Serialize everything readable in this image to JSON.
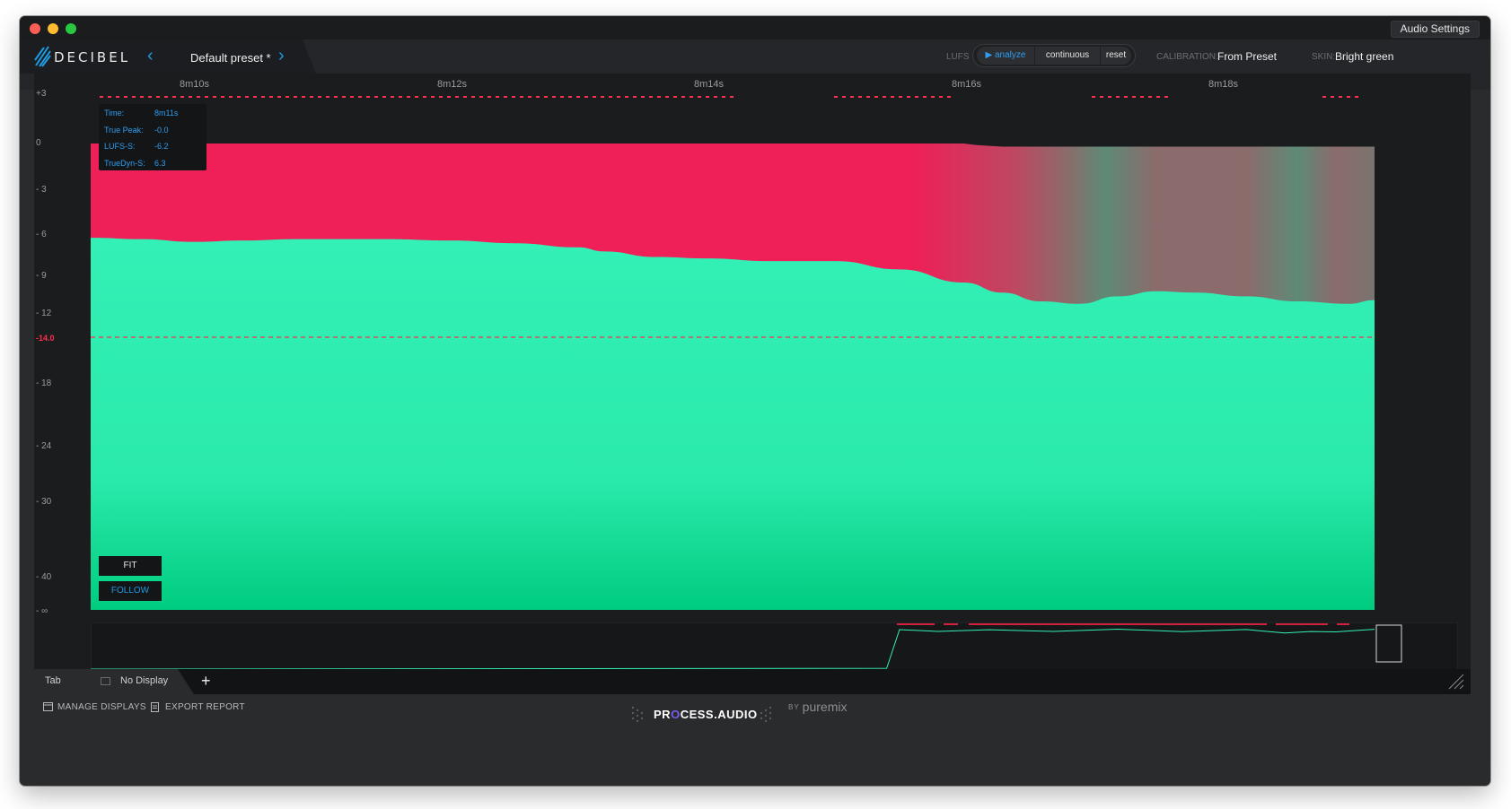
{
  "titlebar": {
    "audio_settings": "Audio Settings"
  },
  "header": {
    "brand": "DECIBEL",
    "preset_name": "Default preset *",
    "lufs_label": "LUFS",
    "analyze": "analyze",
    "continuous": "continuous",
    "reset": "reset",
    "calibration_label": "CALIBRATION:",
    "calibration_value": "From Preset",
    "skin_label": "SKIN:",
    "skin_value": "Bright green"
  },
  "time_axis": [
    "8m10s",
    "8m12s",
    "8m14s",
    "8m16s",
    "8m18s"
  ],
  "y_axis": [
    "+3",
    "0",
    "- 3",
    "- 6",
    "- 9",
    "- 12",
    "-14.0",
    "- 18",
    "- 24",
    "- 30",
    "- 40",
    "- ∞"
  ],
  "info": {
    "rows": [
      {
        "label": "Time:",
        "value": "8m11s"
      },
      {
        "label": "True Peak:",
        "value": "-0.0"
      },
      {
        "label": "LUFS-S:",
        "value": "-6.2"
      },
      {
        "label": "TrueDyn-S:",
        "value": "6.3"
      }
    ]
  },
  "controls": {
    "fit": "FIT",
    "follow": "FOLLOW"
  },
  "tabs": {
    "tab": "Tab",
    "no_display": "No Display",
    "add": "+"
  },
  "footer": {
    "manage_displays": "MANAGE DISPLAYS",
    "export_report": "EXPORT REPORT",
    "process_pre": "PR",
    "process_o": "O",
    "process_post": "CESS.AUDIO",
    "by": "BY",
    "puremix": "puremix"
  },
  "colors": {
    "loudness": "#33f0b6",
    "true_peak": "#ef1f58",
    "target_line": "#ff2f4e",
    "accent": "#1e9be0"
  },
  "chart_data": {
    "type": "area",
    "x_unit": "seconds",
    "xlim": [
      489.2,
      499.2
    ],
    "target_lufs": -14.0,
    "series": [
      {
        "name": "True Peak",
        "x": [
          489.2,
          490,
          491,
          492,
          493,
          494,
          495,
          496,
          496.1,
          496.3,
          497,
          498,
          499.2
        ],
        "values": [
          0.0,
          0.0,
          0.0,
          0.0,
          0.0,
          0.0,
          0.0,
          0.0,
          -0.1,
          -0.2,
          -0.2,
          -0.2,
          -0.2
        ]
      },
      {
        "name": "LUFS-S",
        "x": [
          489.2,
          489.6,
          490,
          490.4,
          490.8,
          491,
          491.5,
          492,
          492.5,
          493,
          493.2,
          493.6,
          494,
          494.5,
          495,
          495.5,
          496,
          496.3,
          496.6,
          496.9,
          497.2,
          497.5,
          497.8,
          498.2,
          498.6,
          499,
          499.2
        ],
        "values": [
          -6.2,
          -6.3,
          -6.5,
          -6.4,
          -6.3,
          -6.3,
          -6.3,
          -6.4,
          -6.6,
          -6.9,
          -7.2,
          -7.6,
          -7.7,
          -7.9,
          -7.9,
          -8.5,
          -9.5,
          -10.3,
          -11.0,
          -11.2,
          -10.6,
          -10.2,
          -10.3,
          -10.6,
          -11.0,
          -11.2,
          -10.9
        ]
      }
    ],
    "overview": {
      "x": [
        0,
        0.62,
        0.63,
        0.66,
        0.7,
        0.75,
        0.8,
        0.85,
        0.9,
        0.93,
        0.95,
        0.97,
        1.0
      ],
      "values": [
        -60,
        -59,
        -8,
        -9,
        -9.5,
        -9,
        -8.8,
        -9.2,
        -9.3,
        -11,
        -12,
        -9.5,
        -9
      ]
    }
  }
}
